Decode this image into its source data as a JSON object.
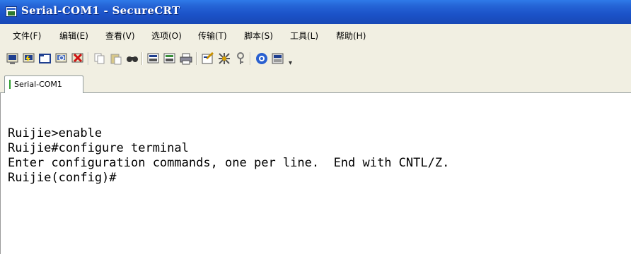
{
  "window": {
    "title": "Serial-COM1 - SecureCRT",
    "icon": "securecrt-app-icon"
  },
  "menu": {
    "items": [
      {
        "label": "文件(F)"
      },
      {
        "label": "编辑(E)"
      },
      {
        "label": "查看(V)"
      },
      {
        "label": "选项(O)"
      },
      {
        "label": "传输(T)"
      },
      {
        "label": "脚本(S)"
      },
      {
        "label": "工具(L)"
      },
      {
        "label": "帮助(H)"
      }
    ]
  },
  "toolbar": {
    "buttons": [
      {
        "icon": "connect-icon"
      },
      {
        "icon": "quick-connect-icon"
      },
      {
        "icon": "connect-in-tab-icon"
      },
      {
        "icon": "reconnect-icon"
      },
      {
        "icon": "disconnect-icon"
      },
      {
        "icon": "copy-icon"
      },
      {
        "icon": "paste-icon"
      },
      {
        "icon": "find-icon"
      },
      {
        "icon": "print-screen-icon"
      },
      {
        "icon": "print-selection-icon"
      },
      {
        "icon": "print-icon"
      },
      {
        "icon": "session-options-icon"
      },
      {
        "icon": "global-options-icon"
      },
      {
        "icon": "keymap-icon"
      },
      {
        "icon": "help-icon"
      },
      {
        "icon": "sftp-icon"
      }
    ],
    "more_glyph": "▾"
  },
  "tabs": [
    {
      "label": "Serial-COM1",
      "active": true,
      "status_color": "#2e9e2e"
    }
  ],
  "terminal": {
    "lines": [
      "Ruijie>enable",
      "Ruijie#configure terminal",
      "Enter configuration commands, one per line.  End with CNTL/Z.",
      "Ruijie(config)#"
    ]
  },
  "colors": {
    "titlebar": "#1b52c8",
    "chrome": "#f1efe2",
    "terminal_bg": "#ffffff",
    "terminal_fg": "#000000"
  }
}
